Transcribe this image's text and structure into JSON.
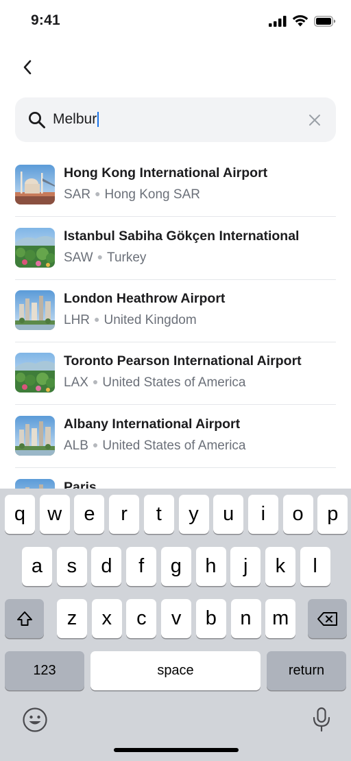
{
  "status_bar": {
    "time": "9:41"
  },
  "search": {
    "query": "Melbur"
  },
  "results": [
    {
      "name": "Hong Kong International Airport",
      "code": "SAR",
      "country": "Hong Kong SAR",
      "thumb": "mosque"
    },
    {
      "name": "Istanbul Sabiha Gökçen International",
      "code": "SAW",
      "country": "Turkey",
      "thumb": "garden"
    },
    {
      "name": "London Heathrow Airport",
      "code": "LHR",
      "country": "United Kingdom",
      "thumb": "city"
    },
    {
      "name": "Toronto Pearson International Airport",
      "code": "LAX",
      "country": "United States of America",
      "thumb": "garden"
    },
    {
      "name": "Albany International Airport",
      "code": "ALB",
      "country": "United States of America",
      "thumb": "city"
    },
    {
      "name": "Paris",
      "code": "",
      "country": "",
      "thumb": "city"
    }
  ],
  "keyboard": {
    "row1": [
      "q",
      "w",
      "e",
      "r",
      "t",
      "y",
      "u",
      "i",
      "o",
      "p"
    ],
    "row2": [
      "a",
      "s",
      "d",
      "f",
      "g",
      "h",
      "j",
      "k",
      "l"
    ],
    "row3": [
      "z",
      "x",
      "c",
      "v",
      "b",
      "n",
      "m"
    ],
    "numbers_label": "123",
    "space_label": "space",
    "return_label": "return"
  },
  "icons": {
    "back": "chevron-left-icon",
    "search": "search-icon",
    "clear": "close-icon",
    "shift": "shift-icon",
    "backspace": "backspace-icon",
    "emoji": "emoji-icon",
    "mic": "microphone-icon"
  }
}
